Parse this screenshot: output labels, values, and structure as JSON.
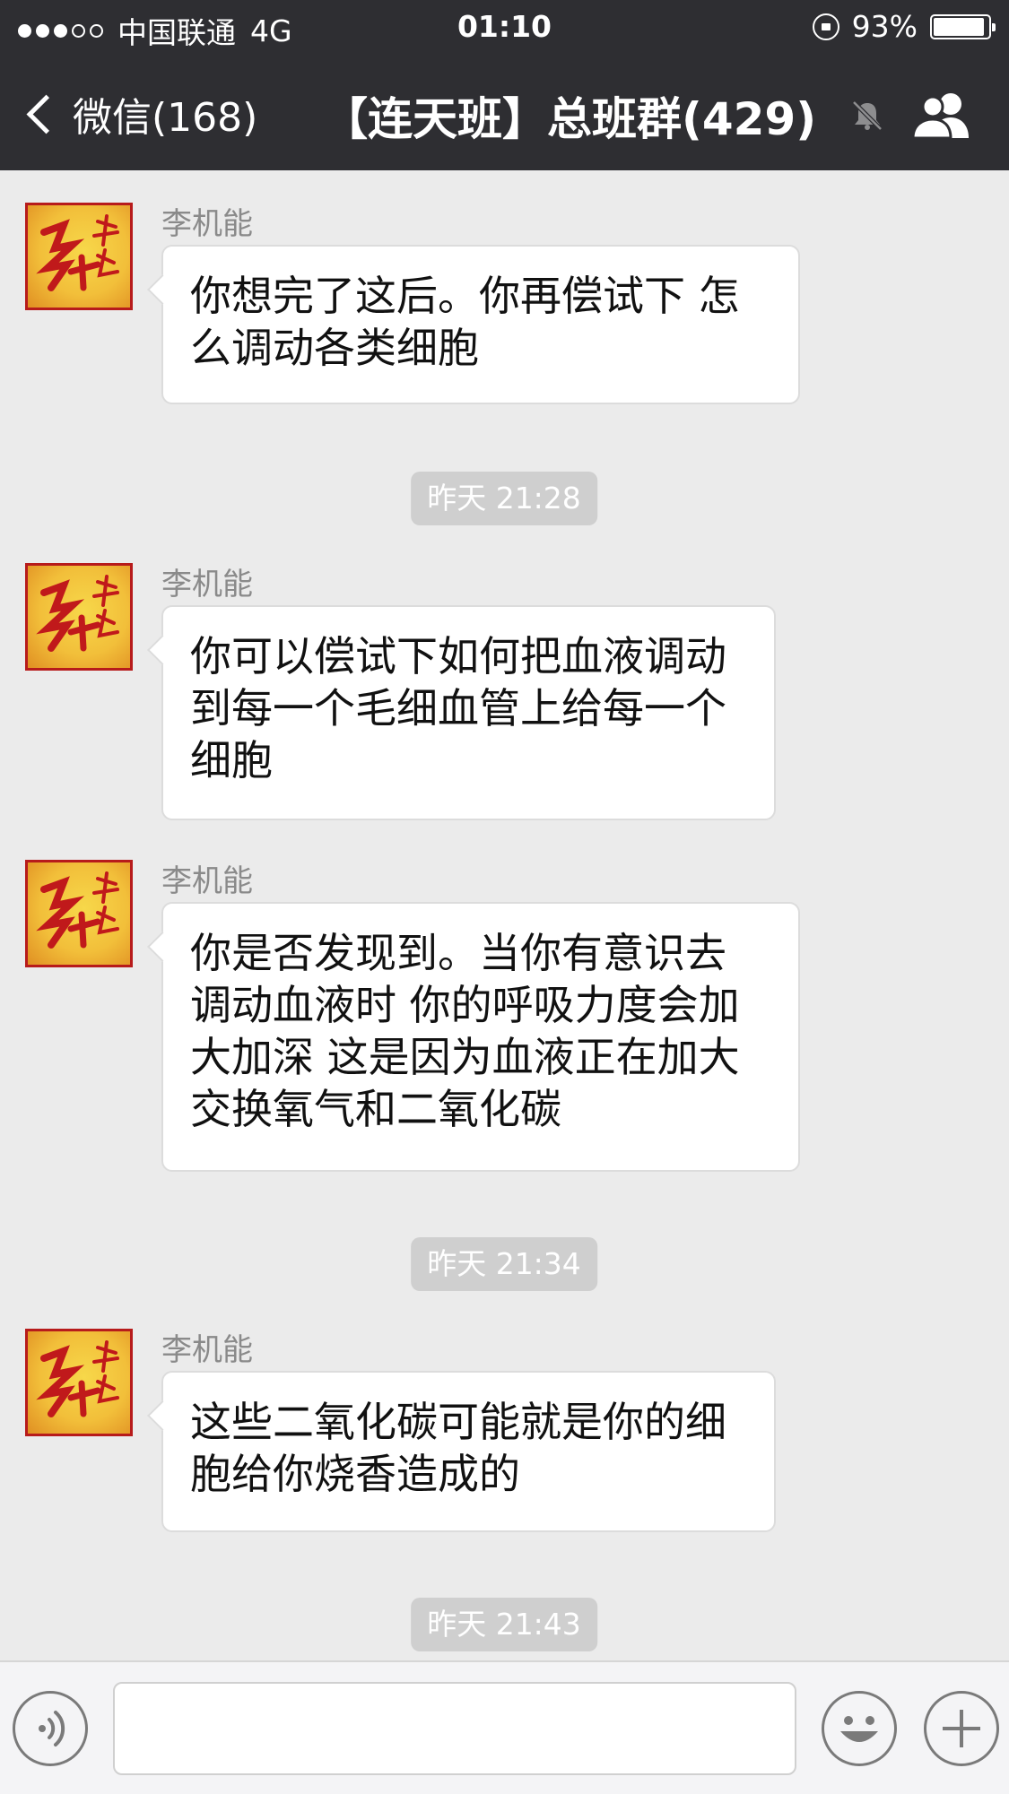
{
  "status_bar": {
    "carrier": "中国联通",
    "network": "4G",
    "time": "01:10",
    "battery_percent": "93%",
    "battery_level": 0.93,
    "signal_bars": 3
  },
  "nav": {
    "back_label": "微信(168)",
    "title": "【连天班】总班群(429)",
    "muted": true
  },
  "messages": [
    {
      "sender": "李机能",
      "lines": [
        "你想完了这后。你再偿试下 怎",
        "么调动各类细胞"
      ]
    },
    {
      "sender": "李机能",
      "lines": [
        "你可以偿试下如何把血液调动",
        "到每一个毛细血管上给每一个",
        "细胞"
      ]
    },
    {
      "sender": "李机能",
      "lines": [
        "你是否发现到。当你有意识去",
        "调动血液时 你的呼吸力度会加",
        "大加深 这是因为血液正在加大",
        "交换氧气和二氧化碳"
      ]
    },
    {
      "sender": "李机能",
      "lines": [
        "这些二氧化碳可能就是你的细",
        "胞给你烧香造成的"
      ]
    }
  ],
  "timestamps": [
    "昨天 21:28",
    "昨天 21:34",
    "昨天 21:43"
  ],
  "input_bar": {
    "text_value": ""
  },
  "colors": {
    "header": "#2e2e32",
    "chat_bg": "#ebebeb",
    "timestamp_bg": "#cfcfcf",
    "avatar_border": "#b71b1b"
  }
}
